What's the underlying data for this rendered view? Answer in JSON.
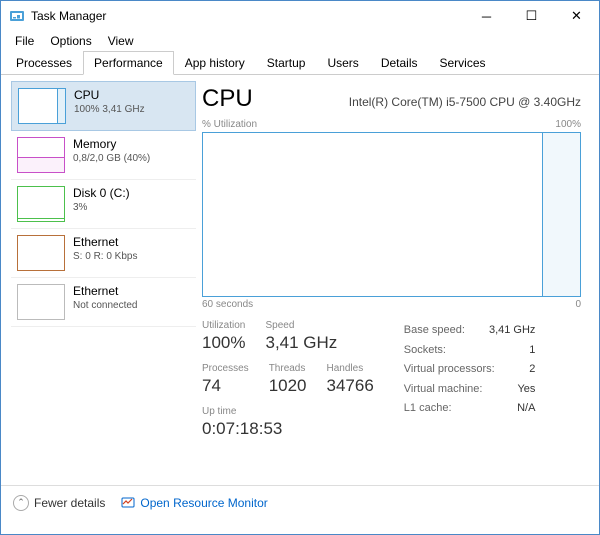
{
  "titlebar": {
    "title": "Task Manager"
  },
  "menu": [
    "File",
    "Options",
    "View"
  ],
  "tabs": [
    "Processes",
    "Performance",
    "App history",
    "Startup",
    "Users",
    "Details",
    "Services"
  ],
  "sidebar": [
    {
      "title": "CPU",
      "sub": "100% 3,41 GHz"
    },
    {
      "title": "Memory",
      "sub": "0,8/2,0 GB (40%)"
    },
    {
      "title": "Disk 0 (C:)",
      "sub": "3%"
    },
    {
      "title": "Ethernet",
      "sub": "S: 0 R: 0 Kbps"
    },
    {
      "title": "Ethernet",
      "sub": "Not connected"
    }
  ],
  "main": {
    "title": "CPU",
    "subtitle": "Intel(R) Core(TM) i5-7500 CPU @ 3.40GHz",
    "graph_top_left": "% Utilization",
    "graph_top_right": "100%",
    "graph_bottom_left": "60 seconds",
    "graph_bottom_right": "0"
  },
  "stats": {
    "utilization_label": "Utilization",
    "utilization": "100%",
    "speed_label": "Speed",
    "speed": "3,41 GHz",
    "processes_label": "Processes",
    "processes": "74",
    "threads_label": "Threads",
    "threads": "1020",
    "handles_label": "Handles",
    "handles": "34766",
    "uptime_label": "Up time",
    "uptime": "0:07:18:53",
    "basespeed_label": "Base speed:",
    "basespeed": "3,41 GHz",
    "sockets_label": "Sockets:",
    "sockets": "1",
    "vprocs_label": "Virtual processors:",
    "vprocs": "2",
    "vmachine_label": "Virtual machine:",
    "vmachine": "Yes",
    "l1_label": "L1 cache:",
    "l1": "N/A"
  },
  "footer": {
    "fewer": "Fewer details",
    "monitor": "Open Resource Monitor"
  },
  "chart_data": {
    "type": "line",
    "title": "% Utilization",
    "xlabel": "seconds",
    "ylabel": "% Utilization",
    "xlim": [
      60,
      0
    ],
    "ylim": [
      0,
      100
    ],
    "series": [
      {
        "name": "CPU",
        "x": [
          60,
          10,
          8,
          6,
          5,
          0
        ],
        "y": [
          0,
          0,
          2,
          95,
          100,
          100
        ]
      }
    ]
  }
}
